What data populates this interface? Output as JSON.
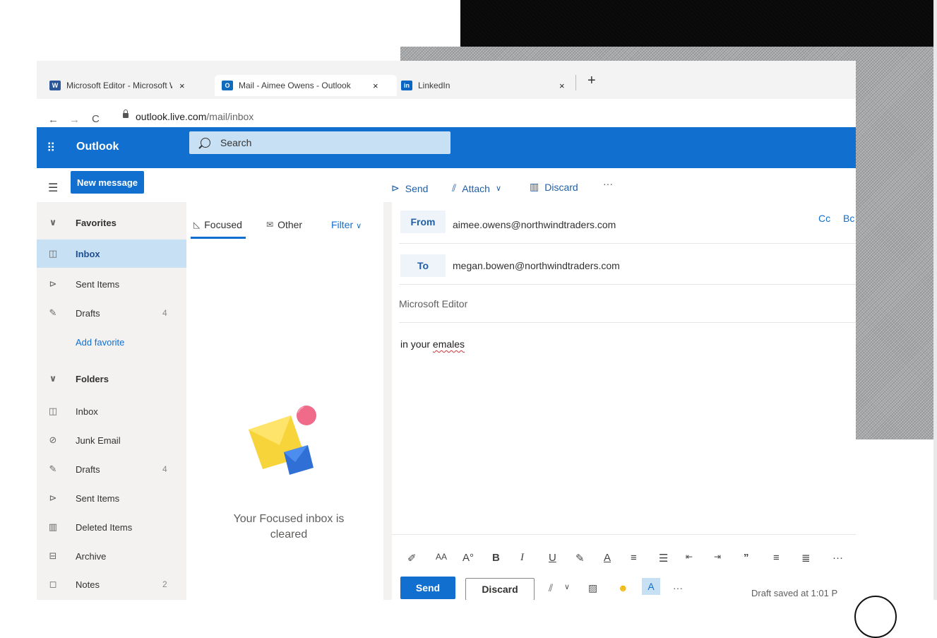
{
  "browser": {
    "tabs": [
      {
        "label": "Microsoft Editor - Microsoft Wor",
        "favicon": "word-icon",
        "color": "#2b579a"
      },
      {
        "label": "Mail - Aimee Owens - Outlook",
        "favicon": "outlook-icon",
        "color": "#0f6cbd"
      },
      {
        "label": "LinkedIn",
        "favicon": "linkedin-icon",
        "color": "#0a66c2"
      }
    ],
    "url_host": "outlook.live.com",
    "url_path": "/mail/inbox",
    "new_tab": "+",
    "close_glyph": "×"
  },
  "outlook": {
    "brand": "Outlook",
    "search_placeholder": "Search",
    "new_message": "New message",
    "commands": {
      "send": "Send",
      "attach": "Attach",
      "discard": "Discard",
      "more": "···"
    },
    "accent": "#1170cf"
  },
  "sidebar": {
    "favorites_header": "Favorites",
    "favorites": [
      {
        "label": "Inbox",
        "count": ""
      },
      {
        "label": "Sent Items",
        "count": ""
      },
      {
        "label": "Drafts",
        "count": "4"
      }
    ],
    "add_favorite": "Add favorite",
    "folders_header": "Folders",
    "folders": [
      {
        "label": "Inbox",
        "count": ""
      },
      {
        "label": "Junk Email",
        "count": ""
      },
      {
        "label": "Drafts",
        "count": "4"
      },
      {
        "label": "Sent Items",
        "count": ""
      },
      {
        "label": "Deleted Items",
        "count": ""
      },
      {
        "label": "Archive",
        "count": ""
      },
      {
        "label": "Notes",
        "count": "2"
      }
    ]
  },
  "message_list": {
    "tab_focused": "Focused",
    "tab_other": "Other",
    "filter": "Filter",
    "empty_line1": "Your Focused inbox is",
    "empty_line2": "cleared"
  },
  "compose": {
    "from_label": "From",
    "from_value": "aimee.owens@northwindtraders.com",
    "to_label": "To",
    "to_value": "megan.bowen@northwindtraders.com",
    "cc": "Cc",
    "bcc": "Bc",
    "subject": "Microsoft Editor",
    "body_prefix": "in your ",
    "body_misspelled": "emales",
    "send": "Send",
    "discard": "Discard",
    "draft_status": "Draft saved at 1:01 P",
    "more": "···",
    "format_more": "···"
  }
}
